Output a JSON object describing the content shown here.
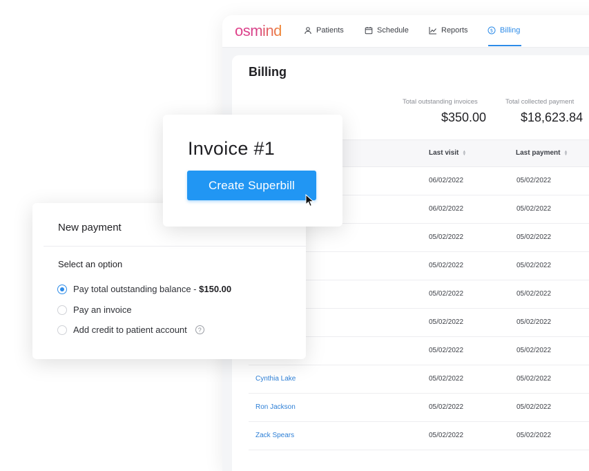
{
  "nav": {
    "logo": "osmind",
    "items": [
      {
        "label": "Patients",
        "icon": "person-icon"
      },
      {
        "label": "Schedule",
        "icon": "calendar-icon"
      },
      {
        "label": "Reports",
        "icon": "chart-icon"
      },
      {
        "label": "Billing",
        "icon": "dollar-circle-icon",
        "active": true
      }
    ]
  },
  "billing": {
    "title": "Billing",
    "stats": {
      "outstanding_label": "Total outstanding invoices",
      "outstanding_value": "$350.00",
      "collected_label": "Total collected payment",
      "collected_value": "$18,623.84"
    },
    "columns": {
      "last_visit": "Last visit",
      "last_payment": "Last payment"
    },
    "rows": [
      {
        "name": "",
        "last_visit": "06/02/2022",
        "last_payment": "05/02/2022"
      },
      {
        "name": "",
        "last_visit": "06/02/2022",
        "last_payment": "05/02/2022"
      },
      {
        "name": "",
        "last_visit": "05/02/2022",
        "last_payment": "05/02/2022"
      },
      {
        "name": "",
        "last_visit": "05/02/2022",
        "last_payment": "05/02/2022"
      },
      {
        "name": "",
        "last_visit": "05/02/2022",
        "last_payment": "05/02/2022"
      },
      {
        "name": "",
        "last_visit": "05/02/2022",
        "last_payment": "05/02/2022"
      },
      {
        "name": "",
        "last_visit": "05/02/2022",
        "last_payment": "05/02/2022"
      },
      {
        "name": "Cynthia Lake",
        "last_visit": "05/02/2022",
        "last_payment": "05/02/2022"
      },
      {
        "name": "Ron Jackson",
        "last_visit": "05/02/2022",
        "last_payment": "05/02/2022"
      },
      {
        "name": "Zack Spears",
        "last_visit": "05/02/2022",
        "last_payment": "05/02/2022"
      }
    ]
  },
  "invoice": {
    "title": "Invoice #1",
    "button_label": "Create Superbill"
  },
  "payment": {
    "title": "New payment",
    "select_label": "Select an option",
    "options": [
      {
        "label": "Pay total outstanding balance - ",
        "amount": "$150.00",
        "selected": true
      },
      {
        "label": "Pay an invoice",
        "selected": false
      },
      {
        "label": "Add credit to patient account",
        "selected": false,
        "help_icon": "question-circle-icon",
        "help_text": "?"
      }
    ]
  },
  "colors": {
    "accent": "#2d8be8",
    "button": "#2196f3",
    "logo_gradient": [
      "#e0418a",
      "#f08a34"
    ]
  }
}
